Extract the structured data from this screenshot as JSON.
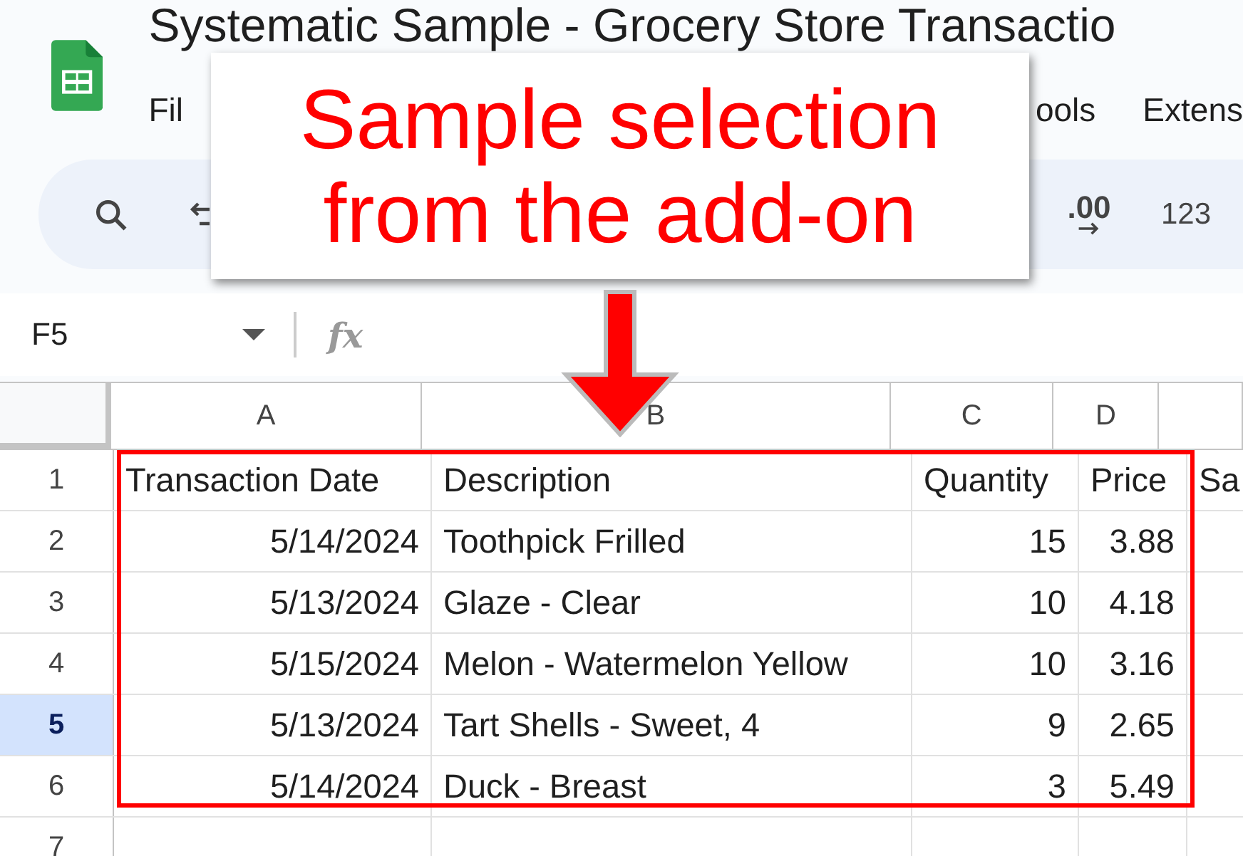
{
  "app": {
    "title": "Systematic Sample - Grocery Store Transactio",
    "menu": [
      "Fil",
      "ools",
      "Extens"
    ]
  },
  "toolbar": [
    {
      "kind": "search"
    },
    {
      "kind": "undo"
    },
    {
      "kind": "decimal",
      "label": ".00"
    },
    {
      "kind": "format",
      "label": "123"
    }
  ],
  "formula_bar": {
    "cell_ref": "F5",
    "fx": "fx"
  },
  "sheet": {
    "columns": [
      "A",
      "B",
      "C",
      "D"
    ],
    "rows": [
      {
        "number": "1",
        "selected": false,
        "kind": "heading",
        "cells": [
          "Transaction Date",
          "Description",
          "Quantity",
          "Price",
          "Sa"
        ]
      },
      {
        "number": "2",
        "selected": false,
        "kind": "data",
        "cells": [
          "5/14/2024",
          "Toothpick Frilled",
          "15",
          "3.88"
        ]
      },
      {
        "number": "3",
        "selected": false,
        "kind": "data",
        "cells": [
          "5/13/2024",
          "Glaze - Clear",
          "10",
          "4.18"
        ]
      },
      {
        "number": "4",
        "selected": false,
        "kind": "data",
        "cells": [
          "5/15/2024",
          "Melon - Watermelon Yellow",
          "10",
          "3.16"
        ]
      },
      {
        "number": "5",
        "selected": true,
        "kind": "data",
        "cells": [
          "5/13/2024",
          "Tart Shells - Sweet, 4",
          "9",
          "2.65"
        ]
      },
      {
        "number": "6",
        "selected": false,
        "kind": "data",
        "cells": [
          "5/14/2024",
          "Duck - Breast",
          "3",
          "5.49"
        ]
      },
      {
        "number": "7",
        "selected": false,
        "kind": "data",
        "cells": []
      }
    ]
  },
  "callout": {
    "text": "Sample selection from the add-on"
  }
}
